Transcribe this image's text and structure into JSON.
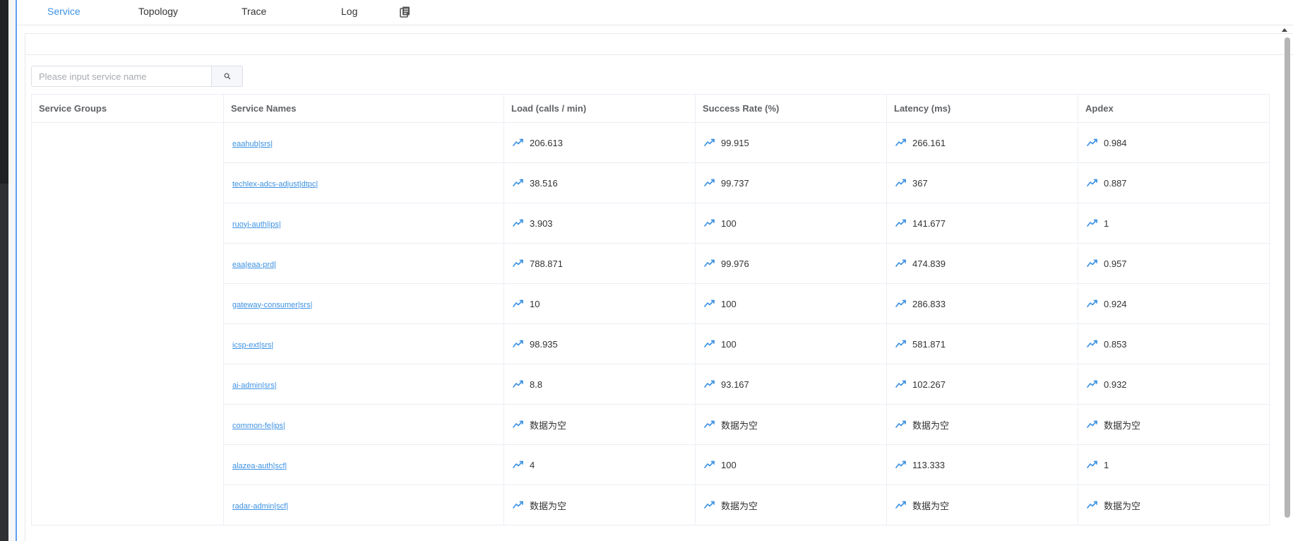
{
  "nav": {
    "tabs": [
      {
        "label": "Service",
        "active": true
      },
      {
        "label": "Topology"
      },
      {
        "label": "Trace"
      },
      {
        "label": "Log"
      }
    ],
    "copy_icon": "copy-icon"
  },
  "search": {
    "placeholder": "Please input service name",
    "value": "",
    "icon": "search-icon"
  },
  "table": {
    "headers": [
      "Service Groups",
      "Service Names",
      "Load (calls / min)",
      "Success Rate (%)",
      "Latency (ms)",
      "Apdex"
    ],
    "group": "",
    "metric_icon": "trend-line-icon",
    "rows": [
      {
        "name": "eaahub|srs|",
        "load": "206.613",
        "success": "99.915",
        "latency": "266.161",
        "apdex": "0.984"
      },
      {
        "name": "techlex-adcs-adjust|dtpc|",
        "load": "38.516",
        "success": "99.737",
        "latency": "367",
        "apdex": "0.887"
      },
      {
        "name": "ruoyi-auth|ips|",
        "load": "3.903",
        "success": "100",
        "latency": "141.677",
        "apdex": "1"
      },
      {
        "name": "eaa|eaa-prd|",
        "load": "788.871",
        "success": "99.976",
        "latency": "474.839",
        "apdex": "0.957"
      },
      {
        "name": "gateway-consumer|srs|",
        "load": "10",
        "success": "100",
        "latency": "286.833",
        "apdex": "0.924"
      },
      {
        "name": "icsp-ext|srs|",
        "load": "98.935",
        "success": "100",
        "latency": "581.871",
        "apdex": "0.853"
      },
      {
        "name": "ai-admin|srs|",
        "load": "8.8",
        "success": "93.167",
        "latency": "102.267",
        "apdex": "0.932"
      },
      {
        "name": "common-fe|ips|",
        "load": "数据为空",
        "success": "数据为空",
        "latency": "数据为空",
        "apdex": "数据为空"
      },
      {
        "name": "alazea-auth|scf|",
        "load": "4",
        "success": "100",
        "latency": "113.333",
        "apdex": "1"
      },
      {
        "name": "radar-admin|scf|",
        "load": "数据为空",
        "success": "数据为空",
        "latency": "数据为空",
        "apdex": "数据为空"
      }
    ]
  },
  "colors": {
    "accent": "#3d92e3",
    "header_text": "#606266",
    "border": "#ebeef5"
  }
}
